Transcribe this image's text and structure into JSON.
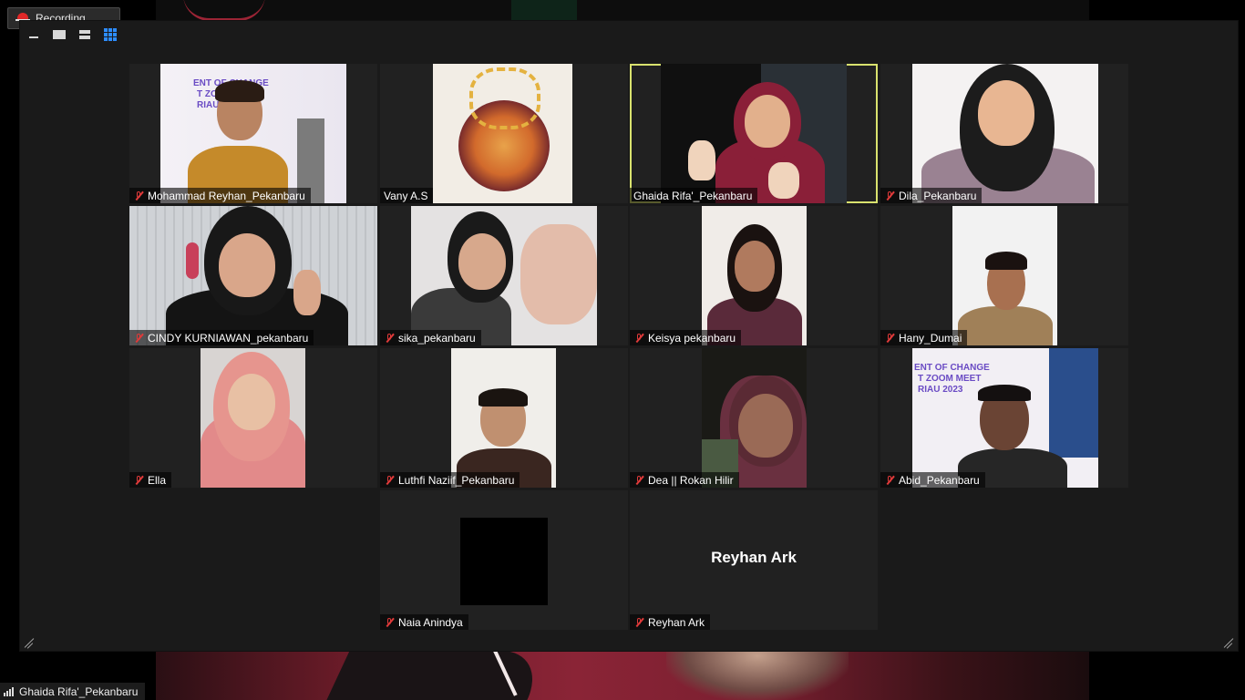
{
  "recording": {
    "label": "Recording..."
  },
  "gallery": {
    "active_speaker": "Ghaida Rifa'_Pekanbaru",
    "participants": [
      {
        "name": "Mohammad Reyhan_Pekanbaru",
        "muted": true
      },
      {
        "name": "Vany A.S",
        "muted": false
      },
      {
        "name": "Ghaida Rifa'_Pekanbaru",
        "muted": false
      },
      {
        "name": "Dila_Pekanbaru",
        "muted": true
      },
      {
        "name": "CINDY KURNIAWAN_pekanbaru",
        "muted": true
      },
      {
        "name": "sika_pekanbaru",
        "muted": true
      },
      {
        "name": "Keisya pekanbaru",
        "muted": true
      },
      {
        "name": "Hany_Dumai",
        "muted": true
      },
      {
        "name": "Ella",
        "muted": true
      },
      {
        "name": "Luthfi Naziif_Pekanbaru",
        "muted": true
      },
      {
        "name": "Dea || Rokan Hilir",
        "muted": true
      },
      {
        "name": "Abid_Pekanbaru",
        "muted": true
      },
      {
        "name": "Naia Anindya",
        "muted": true
      },
      {
        "name": "Reyhan Ark",
        "muted": true
      }
    ],
    "video_off_name": "Reyhan Ark",
    "banner": {
      "line1": "ENT OF CHANGE",
      "line2": "T ZOOM MEET",
      "line3": "RIAU 2023"
    }
  },
  "bottom_bar": {
    "speaker_label": "Ghaida Rifa'_Pekanbaru"
  },
  "colors": {
    "active_border": "#d9e26e",
    "muted_mic": "#e03a3a",
    "view_accent": "#2d8cff"
  },
  "icons": [
    "record-icon",
    "minimize-icon",
    "speaker-view-icon",
    "strip-view-icon",
    "gallery-view-icon",
    "mic-muted-icon",
    "resize-icon",
    "signal-icon"
  ]
}
